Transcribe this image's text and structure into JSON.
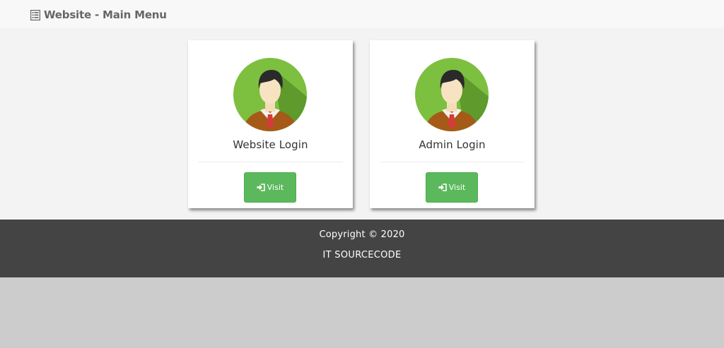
{
  "navbar": {
    "brand_label": "Website - Main Menu",
    "brand_icon": "list-alt-icon"
  },
  "cards": [
    {
      "title": "Website Login",
      "avatar_icon": "user-avatar-icon",
      "button_label": "Visit",
      "button_icon": "sign-in-icon"
    },
    {
      "title": "Admin Login",
      "avatar_icon": "user-avatar-icon",
      "button_label": "Visit",
      "button_icon": "sign-in-icon"
    }
  ],
  "footer": {
    "copyright": "Copyright © 2020",
    "company": "IT SOURCECODE"
  },
  "colors": {
    "button": "#5cb85c",
    "footer": "#444444",
    "avatar_bg": "#7dbf3f",
    "navbar": "#f8f8f8"
  }
}
